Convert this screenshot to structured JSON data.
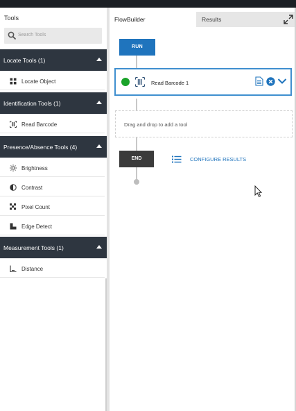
{
  "sidebar": {
    "title": "Tools",
    "search_placeholder": "Search Tools",
    "categories": [
      {
        "label": "Locate Tools (1)",
        "tools": [
          {
            "label": "Locate Object",
            "icon": "locate-object-icon"
          }
        ]
      },
      {
        "label": "Identification Tools (1)",
        "tools": [
          {
            "label": "Read Barcode",
            "icon": "barcode-icon"
          }
        ]
      },
      {
        "label": "Presence/Absence Tools (4)",
        "tools": [
          {
            "label": "Brightness",
            "icon": "brightness-icon"
          },
          {
            "label": "Contrast",
            "icon": "contrast-icon"
          },
          {
            "label": "Pixel Count",
            "icon": "pixel-count-icon"
          },
          {
            "label": "Edge Detect",
            "icon": "edge-detect-icon"
          }
        ]
      },
      {
        "label": "Measurement Tools (1)",
        "tools": [
          {
            "label": "Distance",
            "icon": "distance-icon"
          }
        ]
      }
    ]
  },
  "tabs": {
    "flowbuilder": "FlowBuilder",
    "results": "Results"
  },
  "flow": {
    "run_label": "RUN",
    "tool_card": {
      "label": "Read Barcode 1",
      "status_color": "#1aa32a"
    },
    "dropzone_text": "Drag and drop to add a tool",
    "end_label": "END",
    "configure_results": "CONFIGURE RESULTS"
  },
  "colors": {
    "category_bg": "#2e3640",
    "accent": "#1f74bd",
    "card_border": "#3f8fcf"
  }
}
